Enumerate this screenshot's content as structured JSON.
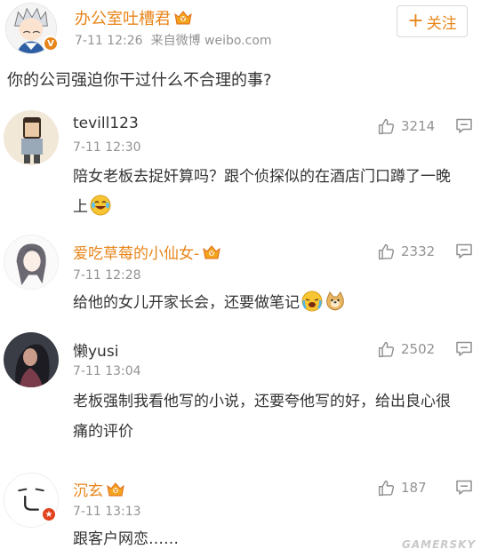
{
  "post": {
    "author": "办公室吐槽君",
    "time": "7-11 12:26",
    "source": "来自微博 weibo.com",
    "follow_label": "关注",
    "text": "你的公司强迫你干过什么不合理的事?"
  },
  "comments": [
    {
      "name": "tevill123",
      "time": "7-11 12:30",
      "likes": "3214",
      "text": "陪女老板去捉奸算吗？跟个侦探似的在酒店门口蹲了一晚上"
    },
    {
      "name": "爱吃草莓的小仙女-",
      "time": "7-11 12:28",
      "likes": "2332",
      "text": "给他的女儿开家长会，还要做笔记"
    },
    {
      "name": "懒yusi",
      "time": "7-11 13:04",
      "likes": "2502",
      "text": "老板强制我看他写的小说，还要夸他写的好，给出良心很痛的评价"
    },
    {
      "name": "沉玄",
      "time": "7-11 13:13",
      "likes": "187",
      "text": "跟客户网恋……"
    }
  ],
  "watermark": "GAMERSKY",
  "colors": {
    "vip_name": "#e8851a",
    "normal_name": "#333333",
    "meta": "#939393"
  },
  "icons": [
    "thumbs-up-icon",
    "reply-icon",
    "vip-crown-icon",
    "verified-icon",
    "plus-icon"
  ]
}
